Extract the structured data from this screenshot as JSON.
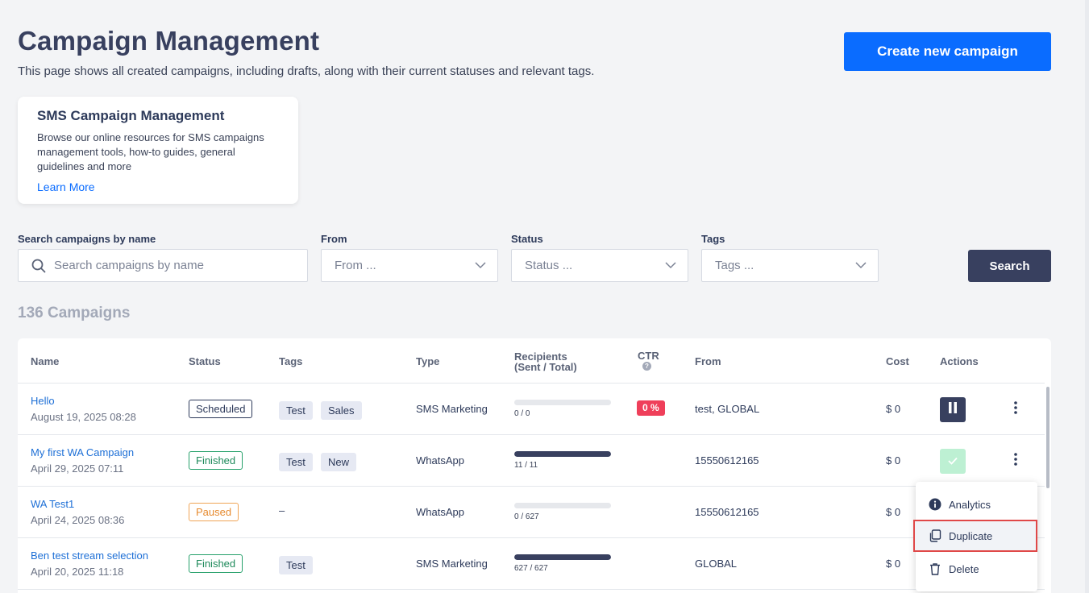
{
  "header": {
    "title": "Campaign Management",
    "subtitle": "This page shows all created campaigns, including drafts, along with their current statuses and relevant tags.",
    "create_button": "Create new campaign"
  },
  "info_card": {
    "title": "SMS Campaign Management",
    "text": "Browse our online resources for SMS campaigns management tools, how-to guides, general guidelines and more",
    "link": "Learn More"
  },
  "filters": {
    "search_label": "Search campaigns by name",
    "search_placeholder": "Search campaigns by name",
    "from_label": "From",
    "from_placeholder": "From ...",
    "status_label": "Status",
    "status_placeholder": "Status ...",
    "tags_label": "Tags",
    "tags_placeholder": "Tags ...",
    "search_button": "Search"
  },
  "count_text": "136 Campaigns",
  "table": {
    "headers": {
      "name": "Name",
      "status": "Status",
      "tags": "Tags",
      "type": "Type",
      "recipients_1": "Recipients",
      "recipients_2": "(Sent / Total)",
      "ctr": "CTR",
      "from": "From",
      "cost": "Cost",
      "actions": "Actions"
    },
    "rows": [
      {
        "name": "Hello",
        "date": "August 19, 2025 08:28",
        "status": "Scheduled",
        "tags": [
          "Test",
          "Sales"
        ],
        "type": "SMS Marketing",
        "recipients": "0 / 0",
        "progress": 0,
        "ctr": "0 %",
        "from": "test,  GLOBAL",
        "cost": "$ 0"
      },
      {
        "name": "My first WA Campaign",
        "date": "April 29, 2025 07:11",
        "status": "Finished",
        "tags": [
          "Test",
          "New"
        ],
        "type": "WhatsApp",
        "recipients": "11 / 11",
        "progress": 1,
        "from": "15550612165",
        "cost": "$ 0"
      },
      {
        "name": "WA Test1",
        "date": "April 24, 2025 08:36",
        "status": "Paused",
        "tags_empty": "–",
        "type": "WhatsApp",
        "recipients": "0 / 627",
        "progress": 0,
        "from": "15550612165",
        "cost": "$ 0"
      },
      {
        "name": "Ben test stream selection",
        "date": "April 20, 2025 11:18",
        "status": "Finished",
        "tags": [
          "Test"
        ],
        "type": "SMS Marketing",
        "recipients": "627 / 627",
        "progress": 1,
        "from": "GLOBAL",
        "cost": "$ 0"
      }
    ]
  },
  "menu": {
    "analytics": "Analytics",
    "duplicate": "Duplicate",
    "delete": "Delete"
  }
}
